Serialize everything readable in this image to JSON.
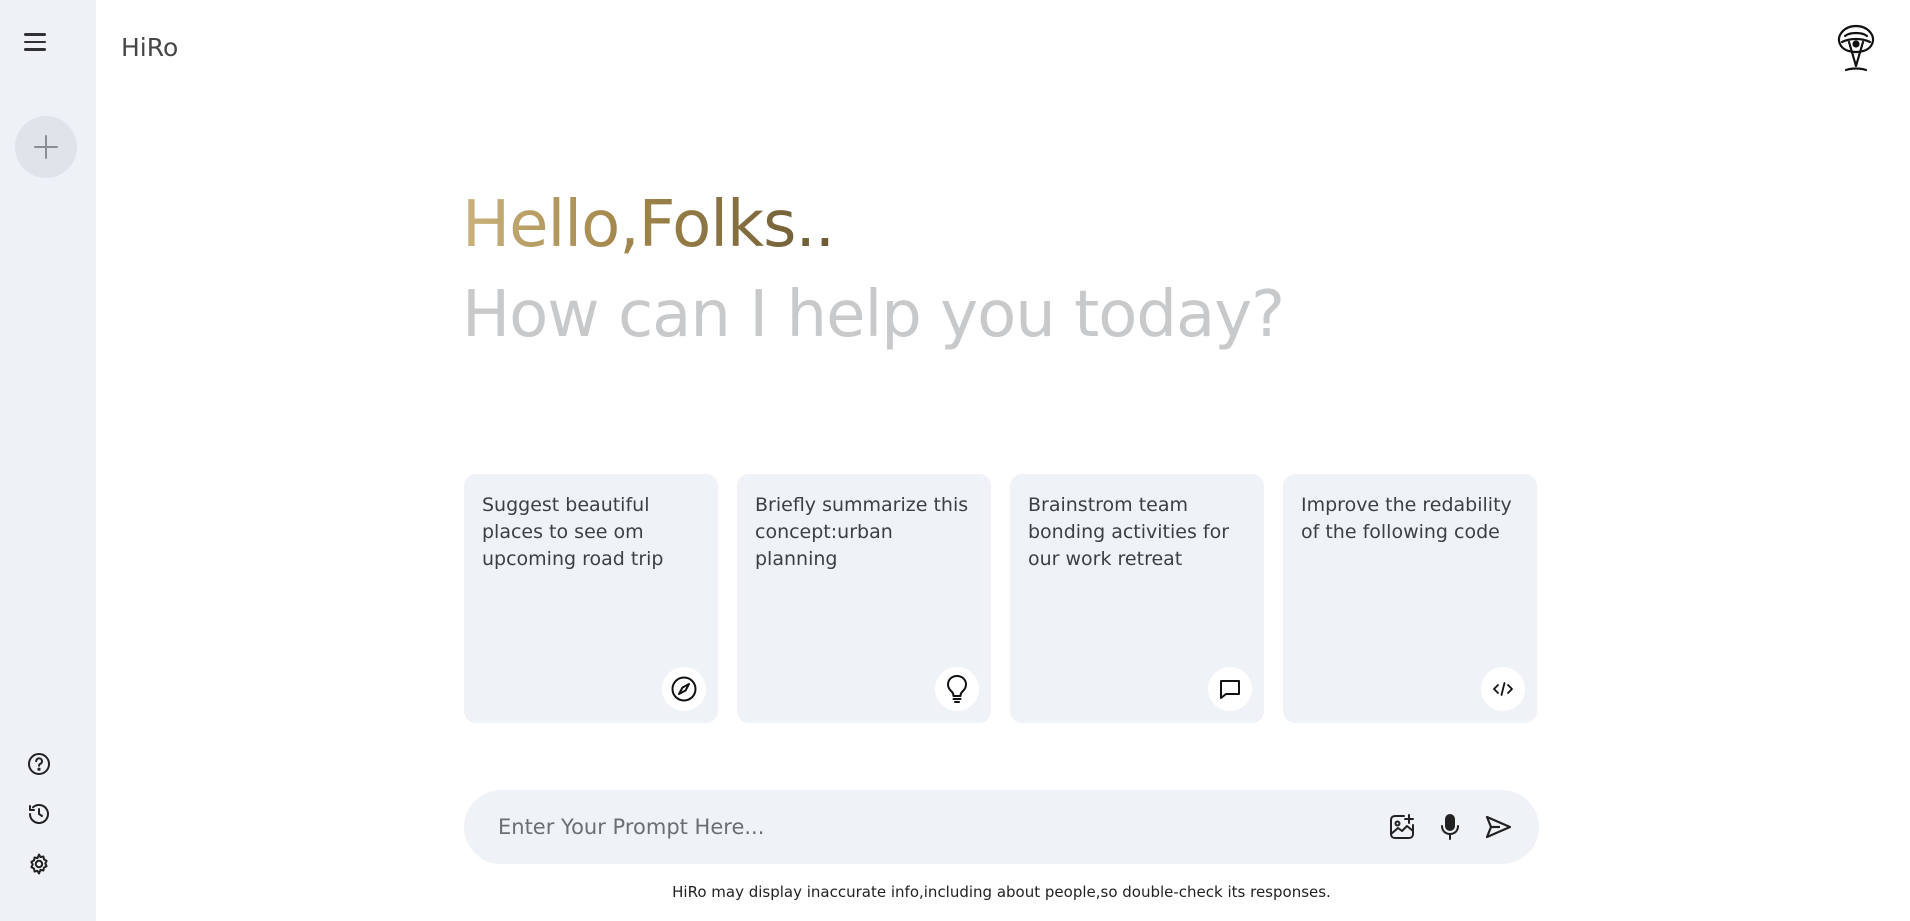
{
  "app": {
    "title": "HiRo"
  },
  "greeting": {
    "hello": "Hello,Folks..",
    "subtitle": "How can I help you today?"
  },
  "cards": [
    {
      "text": "Suggest beautiful places to see om upcoming road trip",
      "icon": "compass-icon"
    },
    {
      "text": "Briefly summarize this concept:urban planning",
      "icon": "lightbulb-icon"
    },
    {
      "text": "Brainstrom team bonding activities for our work retreat",
      "icon": "message-icon"
    },
    {
      "text": "Improve the redability of the following code",
      "icon": "code-icon"
    }
  ],
  "prompt": {
    "placeholder": "Enter Your Prompt Here..."
  },
  "disclaimer": "HiRo may display inaccurate info,including about people,so double-check its responses.",
  "colors": {
    "sidebar": "#eef1f6",
    "card": "#eff2f6",
    "accent_start": "#c9b27c",
    "accent_end": "#6b5a34",
    "subtitle": "#c8c9cb"
  }
}
